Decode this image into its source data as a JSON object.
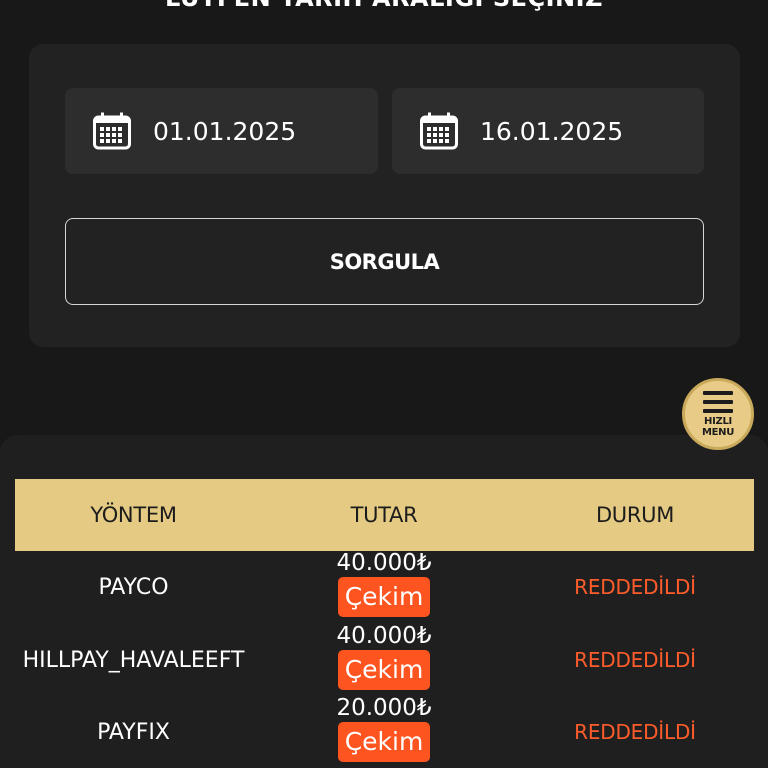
{
  "heading": "LÜTFEN TARİH ARALIĞI SEÇİNİZ",
  "filter": {
    "start_date": "01.01.2025",
    "end_date": "16.01.2025",
    "query_label": "SORGULA"
  },
  "fab": {
    "line1": "HIZLI",
    "line2": "MENU"
  },
  "table": {
    "headers": [
      "YÖNTEM",
      "TUTAR",
      "DURUM"
    ],
    "rows": [
      {
        "method": "PAYCO",
        "amount": "40.000₺",
        "type": "Çekim",
        "status": "REDDEDİLDİ"
      },
      {
        "method": "HILLPAY_HAVALEEFT",
        "amount": "40.000₺",
        "type": "Çekim",
        "status": "REDDEDİLDİ"
      },
      {
        "method": "PAYFIX",
        "amount": "20.000₺",
        "type": "Çekim",
        "status": "REDDEDİLDİ"
      }
    ]
  },
  "colors": {
    "accent_gold": "#e4ca82",
    "badge_orange": "#fd5420",
    "status_red": "#fd5c2b",
    "background": "#181818"
  },
  "icons": {
    "date": "calendar-icon",
    "menu": "hamburger-menu-icon"
  }
}
